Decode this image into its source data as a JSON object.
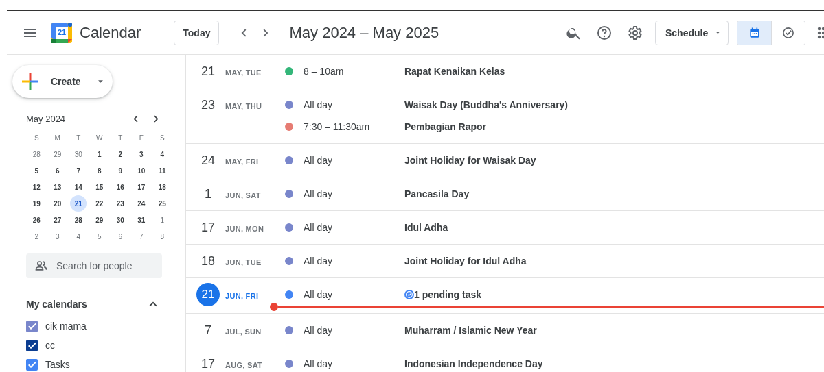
{
  "header": {
    "title": "Calendar",
    "logo_day": "21",
    "today_button": "Today",
    "date_range": "May 2024 – May 2025",
    "view_menu": "Schedule",
    "view_toggle": [
      {
        "kind": "calendar",
        "selected": true
      },
      {
        "kind": "tasks",
        "selected": false
      }
    ]
  },
  "sidebar": {
    "create_button": "Create",
    "mini_calendar": {
      "month": "May 2024",
      "weekdays": [
        "S",
        "M",
        "T",
        "W",
        "T",
        "F",
        "S"
      ],
      "weeks": [
        [
          {
            "d": "28",
            "muted": true,
            "selected": false
          },
          {
            "d": "29",
            "muted": true,
            "selected": false
          },
          {
            "d": "30",
            "muted": true,
            "selected": false
          },
          {
            "d": "1",
            "muted": false,
            "selected": false
          },
          {
            "d": "2",
            "muted": false,
            "selected": false
          },
          {
            "d": "3",
            "muted": false,
            "selected": false
          },
          {
            "d": "4",
            "muted": false,
            "selected": false
          }
        ],
        [
          {
            "d": "5",
            "muted": false,
            "selected": false
          },
          {
            "d": "6",
            "muted": false,
            "selected": false
          },
          {
            "d": "7",
            "muted": false,
            "selected": false
          },
          {
            "d": "8",
            "muted": false,
            "selected": false
          },
          {
            "d": "9",
            "muted": false,
            "selected": false
          },
          {
            "d": "10",
            "muted": false,
            "selected": false
          },
          {
            "d": "11",
            "muted": false,
            "selected": false
          }
        ],
        [
          {
            "d": "12",
            "muted": false,
            "selected": false
          },
          {
            "d": "13",
            "muted": false,
            "selected": false
          },
          {
            "d": "14",
            "muted": false,
            "selected": false
          },
          {
            "d": "15",
            "muted": false,
            "selected": false
          },
          {
            "d": "16",
            "muted": false,
            "selected": false
          },
          {
            "d": "17",
            "muted": false,
            "selected": false
          },
          {
            "d": "18",
            "muted": false,
            "selected": false
          }
        ],
        [
          {
            "d": "19",
            "muted": false,
            "selected": false
          },
          {
            "d": "20",
            "muted": false,
            "selected": false
          },
          {
            "d": "21",
            "muted": false,
            "selected": true
          },
          {
            "d": "22",
            "muted": false,
            "selected": false
          },
          {
            "d": "23",
            "muted": false,
            "selected": false
          },
          {
            "d": "24",
            "muted": false,
            "selected": false
          },
          {
            "d": "25",
            "muted": false,
            "selected": false
          }
        ],
        [
          {
            "d": "26",
            "muted": false,
            "selected": false
          },
          {
            "d": "27",
            "muted": false,
            "selected": false
          },
          {
            "d": "28",
            "muted": false,
            "selected": false
          },
          {
            "d": "29",
            "muted": false,
            "selected": false
          },
          {
            "d": "30",
            "muted": false,
            "selected": false
          },
          {
            "d": "31",
            "muted": false,
            "selected": false
          },
          {
            "d": "1",
            "muted": true,
            "selected": false
          }
        ],
        [
          {
            "d": "2",
            "muted": true,
            "selected": false
          },
          {
            "d": "3",
            "muted": true,
            "selected": false
          },
          {
            "d": "4",
            "muted": true,
            "selected": false
          },
          {
            "d": "5",
            "muted": true,
            "selected": false
          },
          {
            "d": "6",
            "muted": true,
            "selected": false
          },
          {
            "d": "7",
            "muted": true,
            "selected": false
          },
          {
            "d": "8",
            "muted": true,
            "selected": false
          }
        ]
      ]
    },
    "people_search": {
      "placeholder": "Search for people"
    },
    "my_calendars": {
      "title": "My calendars",
      "expanded": true,
      "items": [
        {
          "name": "cik mama",
          "color": "#7986cb",
          "checked": true
        },
        {
          "name": "cc",
          "color": "#0b3d91",
          "checked": true
        },
        {
          "name": "Tasks",
          "color": "#4285f4",
          "checked": true
        }
      ]
    }
  },
  "schedule": [
    {
      "day": "21",
      "label": "MAY, TUE",
      "today": false,
      "events": [
        {
          "kind": "event",
          "time": "8 – 10am",
          "title": "Rapat Kenaikan Kelas",
          "color": "#33b679"
        }
      ]
    },
    {
      "day": "23",
      "label": "MAY, THU",
      "today": false,
      "events": [
        {
          "kind": "event",
          "time": "All day",
          "title": "Waisak Day (Buddha's Anniversary)",
          "color": "#7986cb"
        },
        {
          "kind": "event",
          "time": "7:30 – 11:30am",
          "title": "Pembagian Rapor",
          "color": "#e67c73"
        }
      ]
    },
    {
      "day": "24",
      "label": "MAY, FRI",
      "today": false,
      "events": [
        {
          "kind": "event",
          "time": "All day",
          "title": "Joint Holiday for Waisak Day",
          "color": "#7986cb"
        }
      ]
    },
    {
      "day": "1",
      "label": "JUN, SAT",
      "today": false,
      "events": [
        {
          "kind": "event",
          "time": "All day",
          "title": "Pancasila Day",
          "color": "#7986cb"
        }
      ]
    },
    {
      "day": "17",
      "label": "JUN, MON",
      "today": false,
      "events": [
        {
          "kind": "event",
          "time": "All day",
          "title": "Idul Adha",
          "color": "#7986cb"
        }
      ]
    },
    {
      "day": "18",
      "label": "JUN, TUE",
      "today": false,
      "events": [
        {
          "kind": "event",
          "time": "All day",
          "title": "Joint Holiday for Idul Adha",
          "color": "#7986cb"
        }
      ]
    },
    {
      "day": "21",
      "label": "JUN, FRI",
      "today": true,
      "events": [
        {
          "kind": "task",
          "time": "All day",
          "title": "1 pending task",
          "color": "#4285f4"
        }
      ]
    },
    {
      "day": "7",
      "label": "JUL, SUN",
      "today": false,
      "events": [
        {
          "kind": "event",
          "time": "All day",
          "title": "Muharram / Islamic New Year",
          "color": "#7986cb"
        }
      ]
    },
    {
      "day": "17",
      "label": "AUG, SAT",
      "today": false,
      "events": [
        {
          "kind": "event",
          "time": "All day",
          "title": "Indonesian Independence Day",
          "color": "#7986cb"
        }
      ]
    }
  ]
}
